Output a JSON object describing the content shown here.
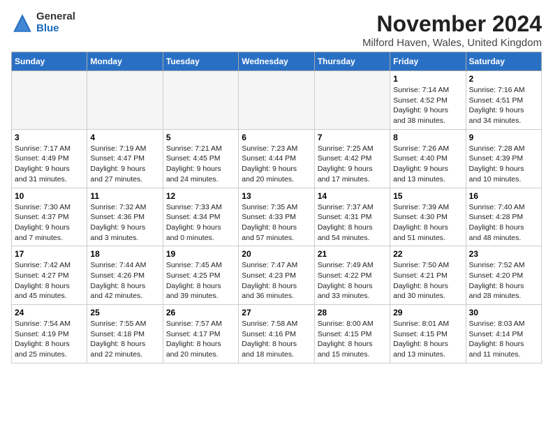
{
  "logo": {
    "general": "General",
    "blue": "Blue"
  },
  "header": {
    "month": "November 2024",
    "location": "Milford Haven, Wales, United Kingdom"
  },
  "weekdays": [
    "Sunday",
    "Monday",
    "Tuesday",
    "Wednesday",
    "Thursday",
    "Friday",
    "Saturday"
  ],
  "weeks": [
    [
      {
        "day": "",
        "info": ""
      },
      {
        "day": "",
        "info": ""
      },
      {
        "day": "",
        "info": ""
      },
      {
        "day": "",
        "info": ""
      },
      {
        "day": "",
        "info": ""
      },
      {
        "day": "1",
        "info": "Sunrise: 7:14 AM\nSunset: 4:52 PM\nDaylight: 9 hours\nand 38 minutes."
      },
      {
        "day": "2",
        "info": "Sunrise: 7:16 AM\nSunset: 4:51 PM\nDaylight: 9 hours\nand 34 minutes."
      }
    ],
    [
      {
        "day": "3",
        "info": "Sunrise: 7:17 AM\nSunset: 4:49 PM\nDaylight: 9 hours\nand 31 minutes."
      },
      {
        "day": "4",
        "info": "Sunrise: 7:19 AM\nSunset: 4:47 PM\nDaylight: 9 hours\nand 27 minutes."
      },
      {
        "day": "5",
        "info": "Sunrise: 7:21 AM\nSunset: 4:45 PM\nDaylight: 9 hours\nand 24 minutes."
      },
      {
        "day": "6",
        "info": "Sunrise: 7:23 AM\nSunset: 4:44 PM\nDaylight: 9 hours\nand 20 minutes."
      },
      {
        "day": "7",
        "info": "Sunrise: 7:25 AM\nSunset: 4:42 PM\nDaylight: 9 hours\nand 17 minutes."
      },
      {
        "day": "8",
        "info": "Sunrise: 7:26 AM\nSunset: 4:40 PM\nDaylight: 9 hours\nand 13 minutes."
      },
      {
        "day": "9",
        "info": "Sunrise: 7:28 AM\nSunset: 4:39 PM\nDaylight: 9 hours\nand 10 minutes."
      }
    ],
    [
      {
        "day": "10",
        "info": "Sunrise: 7:30 AM\nSunset: 4:37 PM\nDaylight: 9 hours\nand 7 minutes."
      },
      {
        "day": "11",
        "info": "Sunrise: 7:32 AM\nSunset: 4:36 PM\nDaylight: 9 hours\nand 3 minutes."
      },
      {
        "day": "12",
        "info": "Sunrise: 7:33 AM\nSunset: 4:34 PM\nDaylight: 9 hours\nand 0 minutes."
      },
      {
        "day": "13",
        "info": "Sunrise: 7:35 AM\nSunset: 4:33 PM\nDaylight: 8 hours\nand 57 minutes."
      },
      {
        "day": "14",
        "info": "Sunrise: 7:37 AM\nSunset: 4:31 PM\nDaylight: 8 hours\nand 54 minutes."
      },
      {
        "day": "15",
        "info": "Sunrise: 7:39 AM\nSunset: 4:30 PM\nDaylight: 8 hours\nand 51 minutes."
      },
      {
        "day": "16",
        "info": "Sunrise: 7:40 AM\nSunset: 4:28 PM\nDaylight: 8 hours\nand 48 minutes."
      }
    ],
    [
      {
        "day": "17",
        "info": "Sunrise: 7:42 AM\nSunset: 4:27 PM\nDaylight: 8 hours\nand 45 minutes."
      },
      {
        "day": "18",
        "info": "Sunrise: 7:44 AM\nSunset: 4:26 PM\nDaylight: 8 hours\nand 42 minutes."
      },
      {
        "day": "19",
        "info": "Sunrise: 7:45 AM\nSunset: 4:25 PM\nDaylight: 8 hours\nand 39 minutes."
      },
      {
        "day": "20",
        "info": "Sunrise: 7:47 AM\nSunset: 4:23 PM\nDaylight: 8 hours\nand 36 minutes."
      },
      {
        "day": "21",
        "info": "Sunrise: 7:49 AM\nSunset: 4:22 PM\nDaylight: 8 hours\nand 33 minutes."
      },
      {
        "day": "22",
        "info": "Sunrise: 7:50 AM\nSunset: 4:21 PM\nDaylight: 8 hours\nand 30 minutes."
      },
      {
        "day": "23",
        "info": "Sunrise: 7:52 AM\nSunset: 4:20 PM\nDaylight: 8 hours\nand 28 minutes."
      }
    ],
    [
      {
        "day": "24",
        "info": "Sunrise: 7:54 AM\nSunset: 4:19 PM\nDaylight: 8 hours\nand 25 minutes."
      },
      {
        "day": "25",
        "info": "Sunrise: 7:55 AM\nSunset: 4:18 PM\nDaylight: 8 hours\nand 22 minutes."
      },
      {
        "day": "26",
        "info": "Sunrise: 7:57 AM\nSunset: 4:17 PM\nDaylight: 8 hours\nand 20 minutes."
      },
      {
        "day": "27",
        "info": "Sunrise: 7:58 AM\nSunset: 4:16 PM\nDaylight: 8 hours\nand 18 minutes."
      },
      {
        "day": "28",
        "info": "Sunrise: 8:00 AM\nSunset: 4:15 PM\nDaylight: 8 hours\nand 15 minutes."
      },
      {
        "day": "29",
        "info": "Sunrise: 8:01 AM\nSunset: 4:15 PM\nDaylight: 8 hours\nand 13 minutes."
      },
      {
        "day": "30",
        "info": "Sunrise: 8:03 AM\nSunset: 4:14 PM\nDaylight: 8 hours\nand 11 minutes."
      }
    ]
  ]
}
